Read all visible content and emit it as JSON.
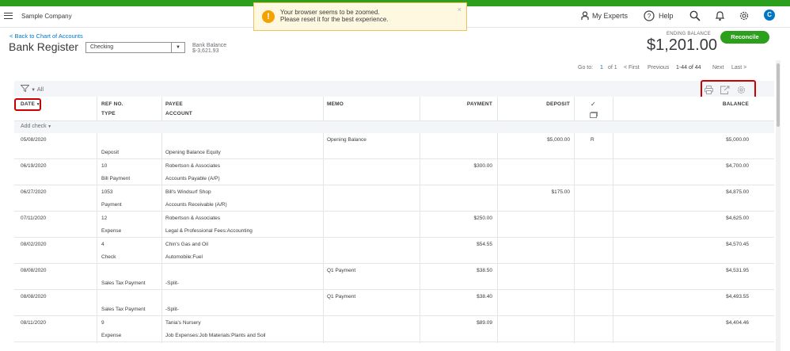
{
  "header": {
    "company": "Sample Company",
    "my_experts": "My Experts",
    "help": "Help",
    "avatar_letter": "C"
  },
  "toast": {
    "line1": "Your browser seems to be zoomed.",
    "line2": "Please reset it for the best experience."
  },
  "register": {
    "back_link": "< Back to Chart of Accounts",
    "title": "Bank Register",
    "account": "Checking",
    "bank_balance_label": "Bank Balance",
    "bank_balance_value": "$-3,621.93",
    "ending_balance_label": "ENDING BALANCE",
    "ending_balance_value": "$1,201.00",
    "reconcile_label": "Reconcile"
  },
  "pager": {
    "goto_label": "Go to:",
    "page": "1",
    "of": "of 1",
    "first": "< First",
    "previous": "Previous",
    "range": "1-44 of 44",
    "next": "Next",
    "last": "Last >"
  },
  "toolbar": {
    "filter_label": "All"
  },
  "columns": {
    "date": "DATE",
    "ref_no": "REF NO.",
    "type": "TYPE",
    "payee": "PAYEE",
    "account": "ACCOUNT",
    "memo": "MEMO",
    "payment": "PAYMENT",
    "deposit": "DEPOSIT",
    "balance": "BALANCE"
  },
  "add_check": "Add check",
  "transactions": [
    {
      "date": "05/08/2020",
      "ref": "",
      "type": "Deposit",
      "payee": "",
      "account": "Opening Balance Equity",
      "memo": "Opening Balance",
      "payment": "",
      "deposit": "$5,000.00",
      "status": "R",
      "balance": "$5,000.00"
    },
    {
      "date": "06/19/2020",
      "ref": "10",
      "type": "Bill Payment",
      "payee": "Robertson & Associates",
      "account": "Accounts Payable (A/P)",
      "memo": "",
      "payment": "$300.00",
      "deposit": "",
      "status": "",
      "balance": "$4,700.00"
    },
    {
      "date": "06/27/2020",
      "ref": "1053",
      "type": "Payment",
      "payee": "Bill's Windsurf Shop",
      "account": "Accounts Receivable (A/R)",
      "memo": "",
      "payment": "",
      "deposit": "$175.00",
      "status": "",
      "balance": "$4,875.00"
    },
    {
      "date": "07/11/2020",
      "ref": "12",
      "type": "Expense",
      "payee": "Robertson & Associates",
      "account": "Legal & Professional Fees:Accounting",
      "memo": "",
      "payment": "$250.00",
      "deposit": "",
      "status": "",
      "balance": "$4,625.00"
    },
    {
      "date": "08/02/2020",
      "ref": "4",
      "type": "Check",
      "payee": "Chin's Gas and Oil",
      "account": "Automobile:Fuel",
      "memo": "",
      "payment": "$54.55",
      "deposit": "",
      "status": "",
      "balance": "$4,570.45"
    },
    {
      "date": "08/08/2020",
      "ref": "",
      "type": "Sales Tax Payment",
      "payee": "",
      "account": "-Split-",
      "memo": "Q1 Payment",
      "payment": "$38.50",
      "deposit": "",
      "status": "",
      "balance": "$4,531.95"
    },
    {
      "date": "08/08/2020",
      "ref": "",
      "type": "Sales Tax Payment",
      "payee": "",
      "account": "-Split-",
      "memo": "Q1 Payment",
      "payment": "$38.40",
      "deposit": "",
      "status": "",
      "balance": "$4,493.55"
    },
    {
      "date": "08/11/2020",
      "ref": "9",
      "type": "Expense",
      "payee": "Tania's Nursery",
      "account": "Job Expenses:Job Materials:Plants and Soil",
      "memo": "",
      "payment": "$89.09",
      "deposit": "",
      "status": "",
      "balance": "$4,404.46"
    }
  ]
}
